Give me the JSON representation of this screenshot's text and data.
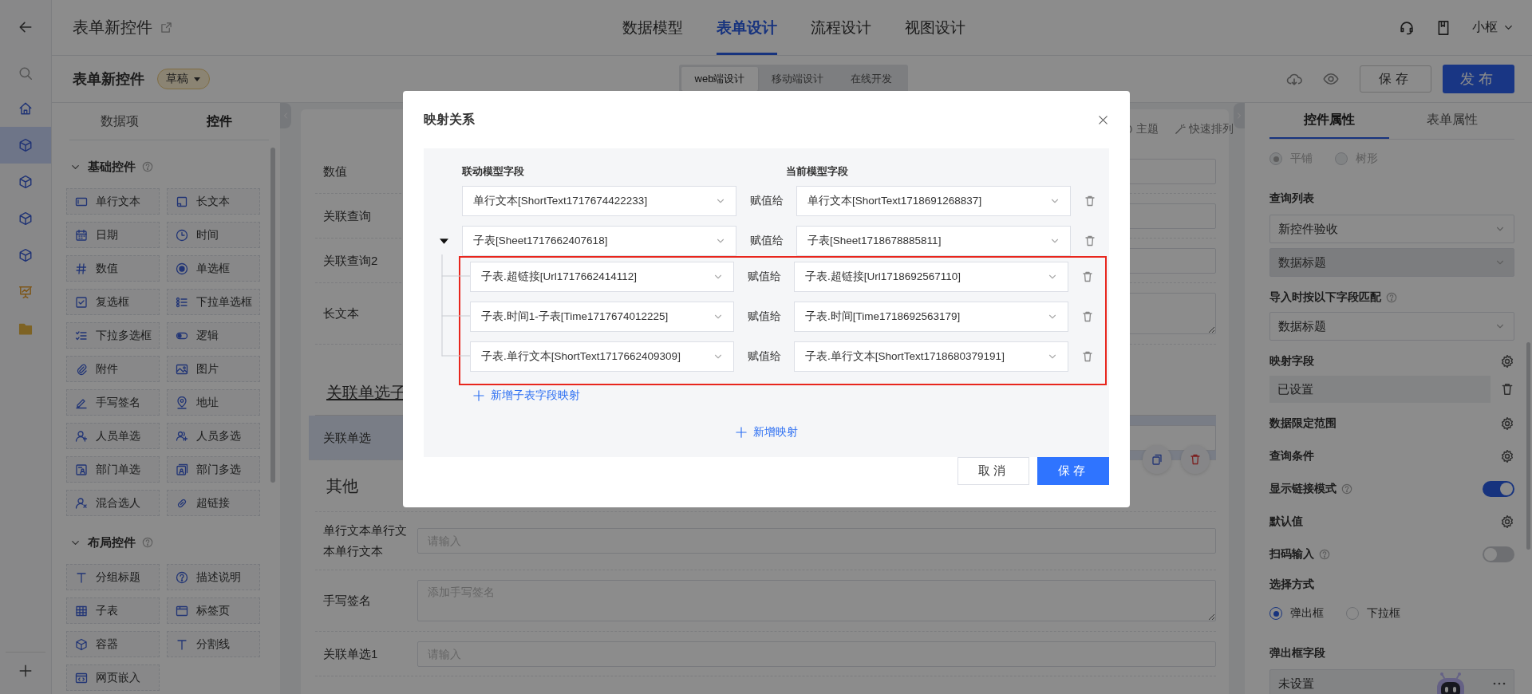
{
  "rail": [
    {
      "kind": "home",
      "selected": false
    },
    {
      "kind": "cube",
      "selected": true
    },
    {
      "kind": "cube",
      "selected": false
    },
    {
      "kind": "cube",
      "selected": false
    },
    {
      "kind": "cube",
      "selected": false
    },
    {
      "kind": "chart",
      "selected": false
    },
    {
      "kind": "folder",
      "selected": false
    }
  ],
  "header": {
    "title": "表单新控件",
    "tabs": [
      {
        "label": "数据模型",
        "selected": false
      },
      {
        "label": "表单设计",
        "selected": true
      },
      {
        "label": "流程设计",
        "selected": false
      },
      {
        "label": "视图设计",
        "selected": false
      }
    ],
    "user": "小枢"
  },
  "toolbar": {
    "form_name": "表单新控件",
    "status": "草稿",
    "modes": [
      {
        "label": "web端设计",
        "selected": true
      },
      {
        "label": "移动端设计",
        "selected": false
      },
      {
        "label": "在线开发",
        "selected": false
      }
    ],
    "save": "保存",
    "publish": "发布"
  },
  "left_panel": {
    "tabs": [
      {
        "label": "数据项",
        "selected": false
      },
      {
        "label": "控件",
        "selected": true
      }
    ],
    "groups": [
      {
        "title": "基础控件",
        "expanded": true,
        "items": [
          {
            "label": "单行文本",
            "kind": "textbox"
          },
          {
            "label": "长文本",
            "kind": "textarea"
          },
          {
            "label": "日期",
            "kind": "calendar"
          },
          {
            "label": "时间",
            "kind": "clock"
          },
          {
            "label": "数值",
            "kind": "number"
          },
          {
            "label": "单选框",
            "kind": "radio"
          },
          {
            "label": "复选框",
            "kind": "checkbox"
          },
          {
            "label": "下拉单选框",
            "kind": "list"
          },
          {
            "label": "下拉多选框",
            "kind": "checklist"
          },
          {
            "label": "逻辑",
            "kind": "toggle"
          },
          {
            "label": "附件",
            "kind": "paperclip"
          },
          {
            "label": "图片",
            "kind": "image"
          },
          {
            "label": "手写签名",
            "kind": "pen"
          },
          {
            "label": "地址",
            "kind": "pin"
          },
          {
            "label": "人员单选",
            "kind": "person"
          },
          {
            "label": "人员多选",
            "kind": "people"
          },
          {
            "label": "部门单选",
            "kind": "card"
          },
          {
            "label": "部门多选",
            "kind": "cards"
          },
          {
            "label": "混合选人",
            "kind": "personx"
          },
          {
            "label": "超链接",
            "kind": "link"
          }
        ]
      },
      {
        "title": "布局控件",
        "expanded": true,
        "items": [
          {
            "label": "分组标题",
            "kind": "title"
          },
          {
            "label": "描述说明",
            "kind": "help"
          },
          {
            "label": "子表",
            "kind": "grid"
          },
          {
            "label": "标签页",
            "kind": "tab"
          },
          {
            "label": "容器",
            "kind": "cube"
          },
          {
            "label": "分割线",
            "kind": "title"
          },
          {
            "label": "网页嵌入",
            "kind": "browser"
          }
        ]
      }
    ]
  },
  "form": {
    "tools": [
      {
        "kind": "theme",
        "label": "主题"
      },
      {
        "kind": "arrange",
        "label": "快速排列"
      }
    ],
    "rows": [
      {
        "kind": "field",
        "label": "数值",
        "selected": false
      },
      {
        "kind": "field",
        "label": "关联查询",
        "selected": false
      },
      {
        "kind": "field",
        "label": "关联查询2",
        "selected": false
      },
      {
        "kind": "textarea",
        "label": "长文本",
        "selected": false
      },
      {
        "kind": "heading",
        "label": "关联单选子",
        "selected": false
      },
      {
        "kind": "field",
        "label": "关联单选",
        "selected": true
      },
      {
        "kind": "section",
        "label": "其他",
        "selected": false
      },
      {
        "kind": "field",
        "label": "单行文本单行文本单行文本",
        "placeholder": "请输入",
        "selected": false
      },
      {
        "kind": "textarea",
        "label": "手写签名",
        "placeholder": "添加手写签名",
        "selected": false
      },
      {
        "kind": "field",
        "label": "关联单选1",
        "placeholder": "请输入",
        "selected": false
      }
    ]
  },
  "right_panel": {
    "tabs": [
      {
        "label": "控件属性",
        "selected": true
      },
      {
        "label": "表单属性",
        "selected": false
      }
    ],
    "properties": [
      {
        "kind": "radio",
        "disabled": true,
        "options": [
          {
            "label": "平铺",
            "selected": true
          },
          {
            "label": "树形",
            "selected": false
          }
        ]
      },
      {
        "kind": "label",
        "text": "查询列表",
        "help": false
      },
      {
        "kind": "select",
        "value": "新控件验收",
        "disabled": false
      },
      {
        "kind": "select",
        "value": "数据标题",
        "disabled": true
      },
      {
        "kind": "label",
        "text": "导入时按以下字段匹配",
        "help": true
      },
      {
        "kind": "select",
        "value": "数据标题",
        "disabled": false
      },
      {
        "kind": "setting",
        "text": "映射字段"
      },
      {
        "kind": "value",
        "value": "已设置"
      },
      {
        "kind": "setting",
        "text": "数据限定范围"
      },
      {
        "kind": "setting",
        "text": "查询条件"
      },
      {
        "kind": "switch",
        "text": "显示链接模式",
        "help": true,
        "on": true
      },
      {
        "kind": "setting",
        "text": "默认值"
      },
      {
        "kind": "switch",
        "text": "扫码输入",
        "help": true,
        "on": false
      },
      {
        "kind": "label",
        "text": "选择方式",
        "help": false
      },
      {
        "kind": "radio",
        "disabled": false,
        "options": [
          {
            "label": "弹出框",
            "selected": true
          },
          {
            "label": "下拉框",
            "selected": false
          }
        ]
      },
      {
        "kind": "label",
        "text": "弹出框字段",
        "help": false
      },
      {
        "kind": "picker",
        "value": "未设置"
      }
    ]
  },
  "modal": {
    "title": "映射关系",
    "source_header": "联动模型字段",
    "target_header": "当前模型字段",
    "mappings": [
      {
        "source": "单行文本[ShortText1717674422233]",
        "assign": "赋值给",
        "target": "单行文本[ShortText1718691268837]"
      },
      {
        "source": "子表[Sheet1717662407618]",
        "assign": "赋值给",
        "target": "子表[Sheet1718678885811]",
        "expanded": true,
        "highlight": true,
        "add_child": "新增子表字段映射",
        "children": [
          {
            "source": "子表.超链接[Url1717662414112]",
            "assign": "赋值给",
            "target": "子表.超链接[Url1718692567110]"
          },
          {
            "source": "子表.时间1-子表[Time1717674012225]",
            "assign": "赋值给",
            "target": "子表.时间[Time1718692563179]"
          },
          {
            "source": "子表.单行文本[ShortText1717662409309]",
            "assign": "赋值给",
            "target": "子表.单行文本[ShortText1718680379191]"
          }
        ]
      }
    ],
    "add": "新增映射",
    "cancel": "取消",
    "save": "保存"
  }
}
